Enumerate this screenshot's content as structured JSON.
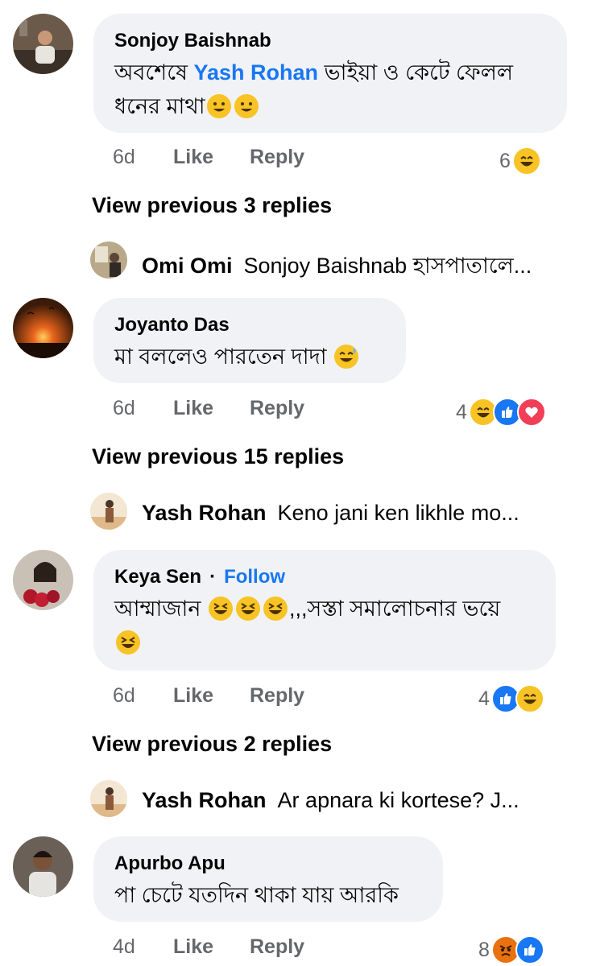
{
  "comments": [
    {
      "name": "Sonjoy Baishnab",
      "text_before": "অবশেষে ",
      "mention": "Yash Rohan",
      "text_after": " ভাইয়া ও কেটে ফেলল",
      "text_line2": "ধনের মাথা",
      "time": "6d",
      "like": "Like",
      "reply": "Reply",
      "reaction_count": "6"
    },
    {
      "name": "Joyanto Das",
      "text": "মা বললেও পারতেন দাদা",
      "time": "6d",
      "like": "Like",
      "reply": "Reply",
      "reaction_count": "4"
    },
    {
      "name": "Keya Sen",
      "follow_dot": "·",
      "follow": "Follow",
      "text_a": "আম্মাজান",
      "text_b": ",,,সস্তা সমালোচনার ভয়ে",
      "time": "6d",
      "like": "Like",
      "reply": "Reply",
      "reaction_count": "4"
    },
    {
      "name": "Apurbo Apu",
      "text": "পা চেটে যতদিন থাকা যায় আরকি",
      "time": "4d",
      "like": "Like",
      "reply": "Reply",
      "reaction_count": "8"
    }
  ],
  "view_previous": [
    "View previous 3 replies",
    "View previous 15 replies",
    "View previous 2 replies"
  ],
  "reply_previews": [
    {
      "name": "Omi Omi",
      "text": "Sonjoy Baishnab হাসপাতালে..."
    },
    {
      "name": "Yash Rohan",
      "text": "Keno jani ken likhle mo..."
    },
    {
      "name": "Yash Rohan",
      "text": "Ar apnara ki kortese? J..."
    }
  ],
  "colors": {
    "link_blue": "#1877f2",
    "bubble_bg": "#f0f2f5",
    "meta_gray": "#65676b",
    "like_blue": "#1877f2",
    "love_red": "#f33e58",
    "angry_orange": "#e9710f",
    "emoji_yellow": "#f7c325"
  },
  "icons": {
    "haha": "haha-reaction-icon",
    "like": "like-reaction-icon",
    "love": "love-reaction-icon",
    "angry": "angry-reaction-icon",
    "smile": "smile-emoji-icon",
    "sweat": "sweat-smile-emoji-icon",
    "laugh": "laughing-emoji-icon"
  }
}
